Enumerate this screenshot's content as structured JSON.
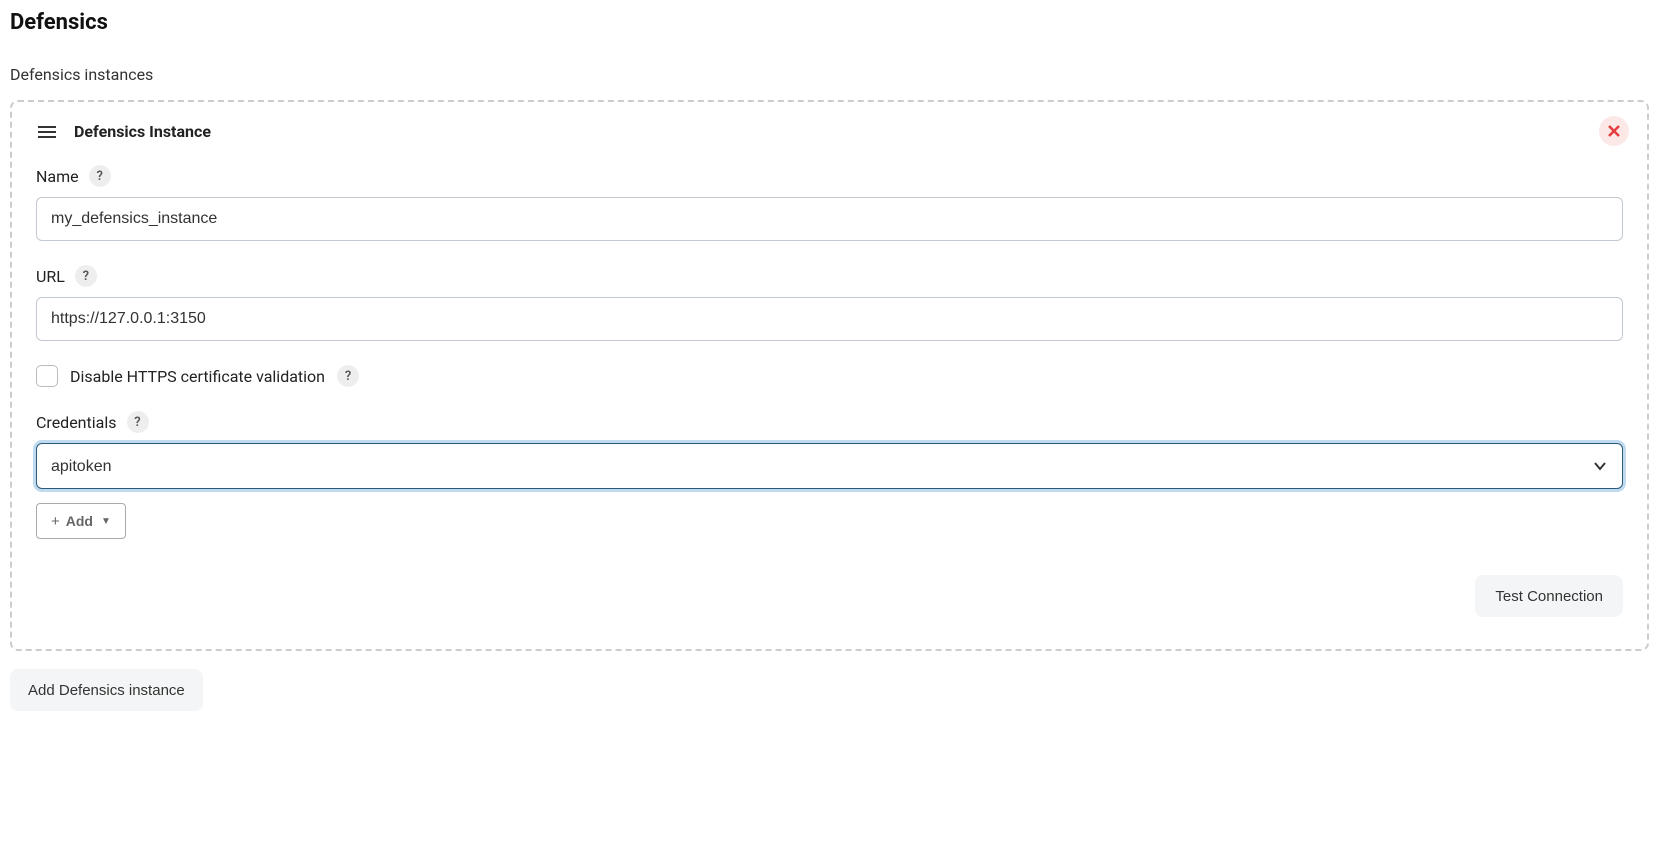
{
  "page": {
    "title": "Defensics",
    "section_label": "Defensics instances",
    "add_instance_button": "Add Defensics instance"
  },
  "instance": {
    "card_title": "Defensics Instance",
    "fields": {
      "name": {
        "label": "Name",
        "value": "my_defensics_instance"
      },
      "url": {
        "label": "URL",
        "value": "https://127.0.0.1:3150"
      },
      "disable_https": {
        "label": "Disable HTTPS certificate validation",
        "checked": false
      },
      "credentials": {
        "label": "Credentials",
        "selected": "apitoken"
      }
    },
    "add_button": "Add",
    "test_button": "Test Connection"
  },
  "help_glyph": "?"
}
